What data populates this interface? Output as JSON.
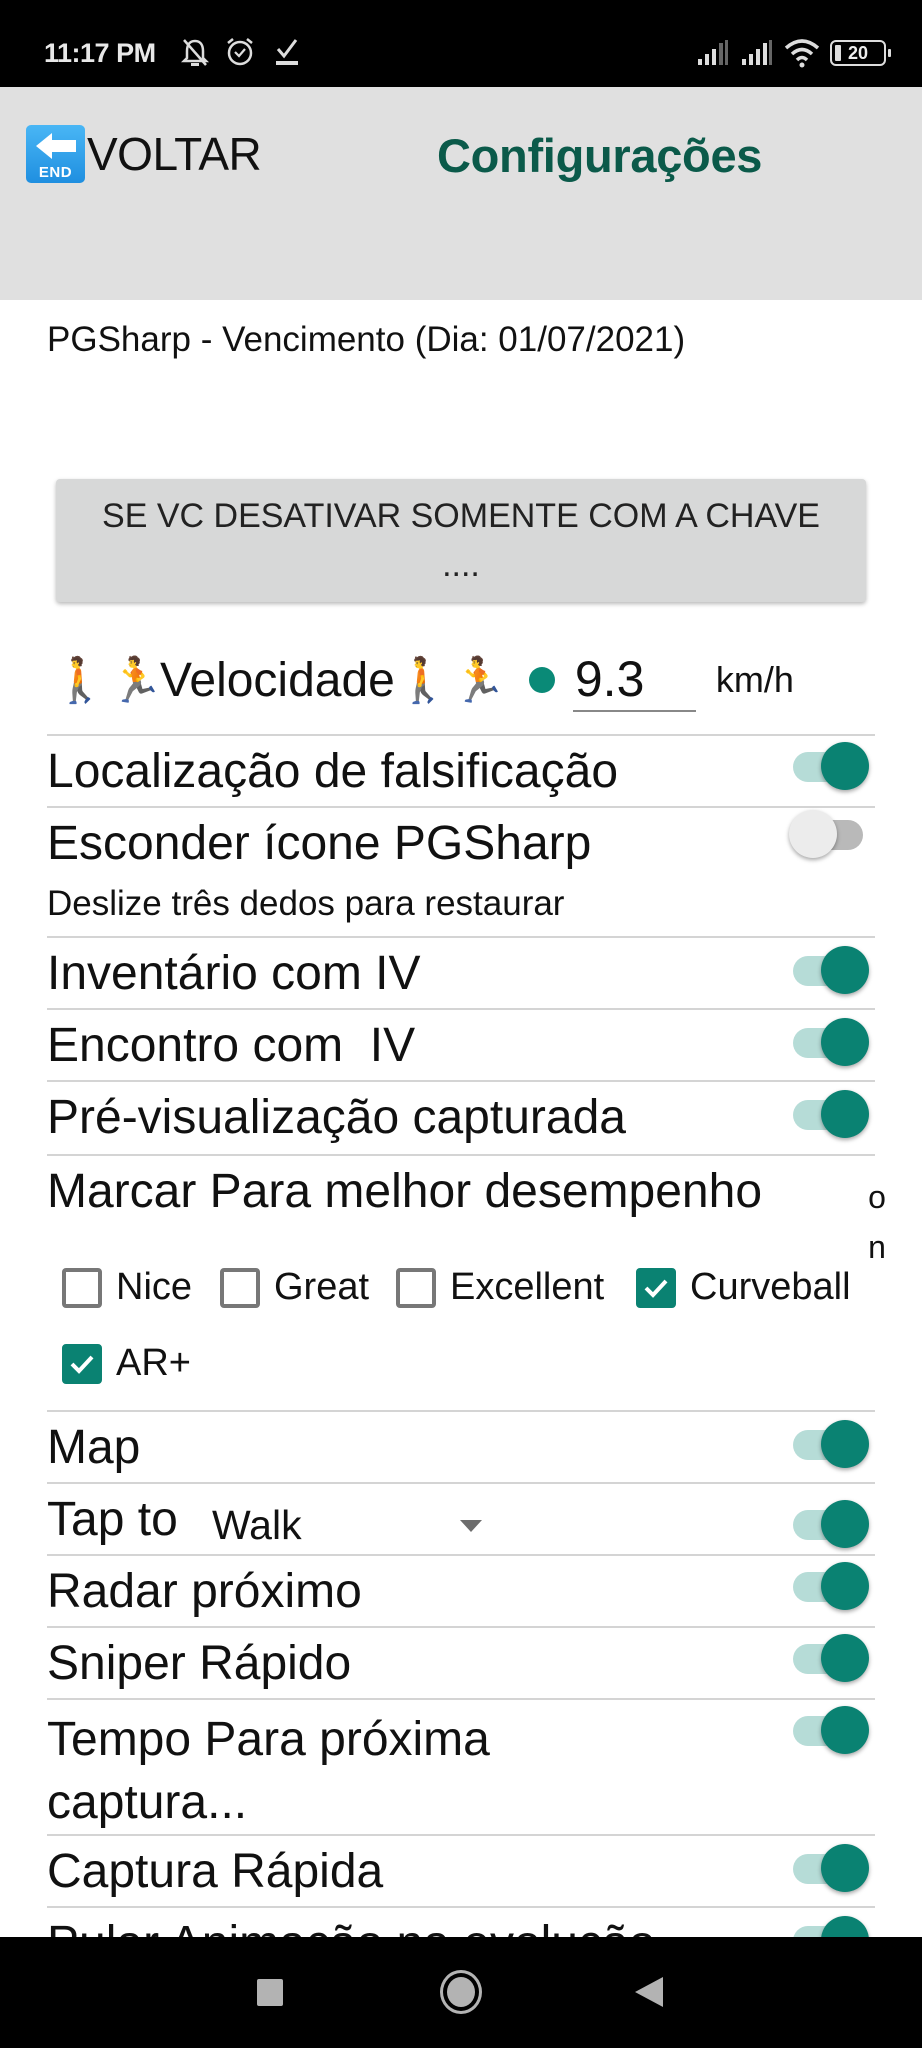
{
  "status_bar": {
    "time": "11:17 PM",
    "left_icons": [
      "muted-bell-icon",
      "alarm-clock-icon",
      "download-done-icon"
    ],
    "right_icons": [
      "signal-1-icon",
      "signal-2-icon",
      "wifi-icon",
      "battery-icon"
    ],
    "battery_level": "20"
  },
  "header": {
    "back_label": "VOLTAR",
    "back_icon_text": "END",
    "title": "Configurações"
  },
  "expiry_text": "PGSharp - Vencimento (Dia: 01/07/2021)",
  "warning_button": "SE VC DESATIVAR SOMENTE COM A CHAVE ....",
  "speed": {
    "emoji_walk": "🚶",
    "emoji_run": "🏃",
    "label": "Velocidade",
    "value": "9.3",
    "unit": "km/h"
  },
  "settings": [
    {
      "label": "Localização de falsificação",
      "on": true
    },
    {
      "label": "Esconder ícone PGSharp",
      "sublabel": "Deslize três dedos para restaurar",
      "on": false
    },
    {
      "label": "Inventário com IV",
      "on": true
    },
    {
      "label": "Encontro com  IV",
      "on": true
    },
    {
      "label": "Pré-visualização capturada",
      "on": true
    },
    {
      "label": "Marcar Para melhor desempenho",
      "vertical_text": [
        "o",
        "n"
      ]
    },
    {
      "label": "Map",
      "on": true
    },
    {
      "label": "Tap to",
      "dropdown_value": "Walk",
      "on": true
    },
    {
      "label": "Radar próximo",
      "on": true
    },
    {
      "label": "Sniper Rápido",
      "on": true
    },
    {
      "label": "Tempo Para próxima captura...",
      "on": true
    },
    {
      "label": "Captura Rápida",
      "on": true
    },
    {
      "label": "Pular Animação na evolução",
      "on": true
    }
  ],
  "throw_checks": [
    {
      "label": "Nice",
      "checked": false
    },
    {
      "label": "Great",
      "checked": false
    },
    {
      "label": "Excellent",
      "checked": false
    },
    {
      "label": "Curveball",
      "checked": true
    },
    {
      "label": "AR+",
      "checked": true
    }
  ],
  "colors": {
    "accent": "#0a8272",
    "title": "#0b5a4a",
    "header_bg": "#e0e0e0",
    "button_bg": "#d7d8d8"
  },
  "navbar": {
    "buttons": [
      "recent-apps",
      "home",
      "back"
    ]
  }
}
